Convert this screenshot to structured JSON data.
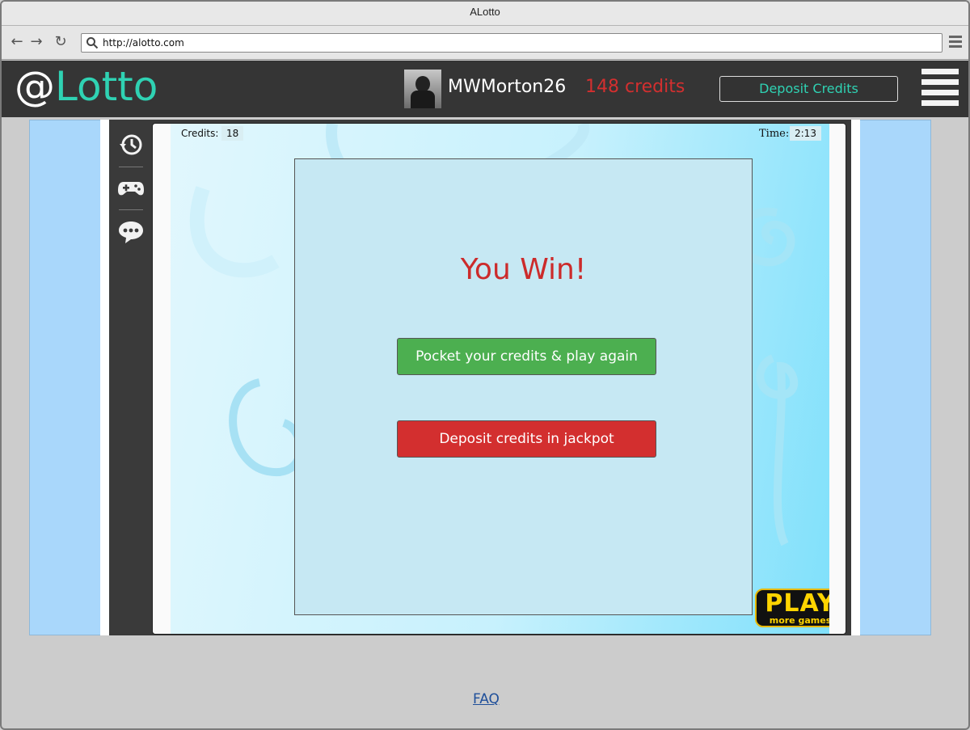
{
  "window": {
    "title": "ALotto"
  },
  "browser": {
    "url": "http://alotto.com"
  },
  "header": {
    "logo_at": "@",
    "logo_text": "Lotto",
    "username": "MWMorton26",
    "credits": "148 credits",
    "deposit_button": "Deposit Credits"
  },
  "sidebar": {
    "items": [
      {
        "icon": "history-icon"
      },
      {
        "icon": "gamepad-icon"
      },
      {
        "icon": "chat-icon"
      }
    ]
  },
  "game": {
    "credits_label": "Credits:",
    "credits_value": "18",
    "time_label": "Time:",
    "time_value": "2:13",
    "win_title": "You Win!",
    "pocket_button": "Pocket your credits & play again",
    "deposit_jackpot_button": "Deposit credits in jackpot",
    "play_badge_big": "PLAY",
    "play_badge_small": "more games"
  },
  "footer": {
    "faq_link": "FAQ"
  },
  "colors": {
    "header_bg": "#353535",
    "logo_accent": "#2fd2b3",
    "credits_red": "#d32f2f",
    "green_button": "#4caf50",
    "red_button": "#d32f2f",
    "content_blue": "#a9d7fb"
  }
}
